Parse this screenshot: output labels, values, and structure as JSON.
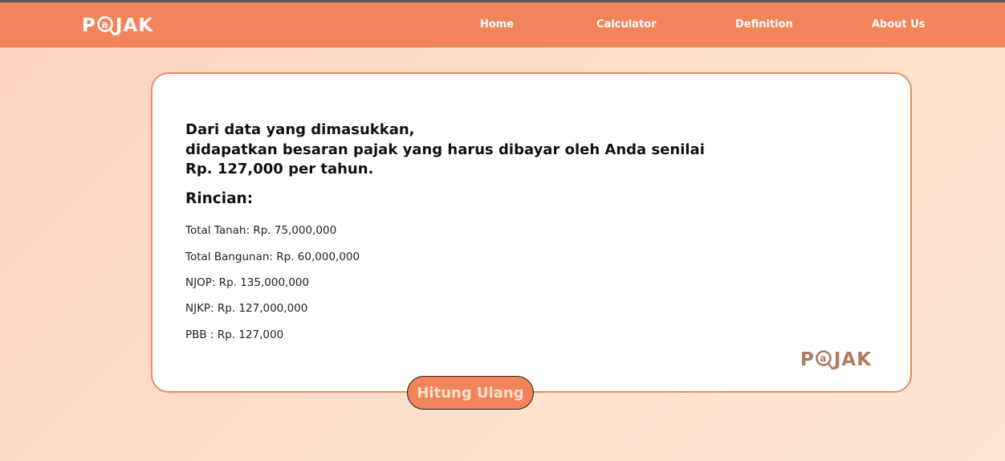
{
  "nav": {
    "logo_text": "PAJAK",
    "items": [
      {
        "label": "Home"
      },
      {
        "label": "Calculator"
      },
      {
        "label": "Definition"
      },
      {
        "label": "About Us"
      }
    ]
  },
  "result": {
    "summary_line1": "Dari data yang dimasukkan,",
    "summary_line2": "didapatkan besaran pajak yang harus dibayar oleh Anda senilai",
    "summary_line3": "Rp. 127,000 per tahun.",
    "details_title": "Rincian:",
    "details": [
      "Total Tanah: Rp. 75,000,000",
      "Total Bangunan: Rp. 60,000,000",
      "NJOP: Rp. 135,000,000",
      "NJKP: Rp. 127,000,000",
      "PBB : Rp. 127,000"
    ],
    "card_logo_text": "PAJAK"
  },
  "button": {
    "label": "Hitung Ulang"
  },
  "colors": {
    "nav_bg": "#f1845b",
    "card_border": "#ee8a64",
    "button_bg": "#f1845b",
    "button_text": "#fde3cf",
    "card_logo": "#b07a5e"
  }
}
